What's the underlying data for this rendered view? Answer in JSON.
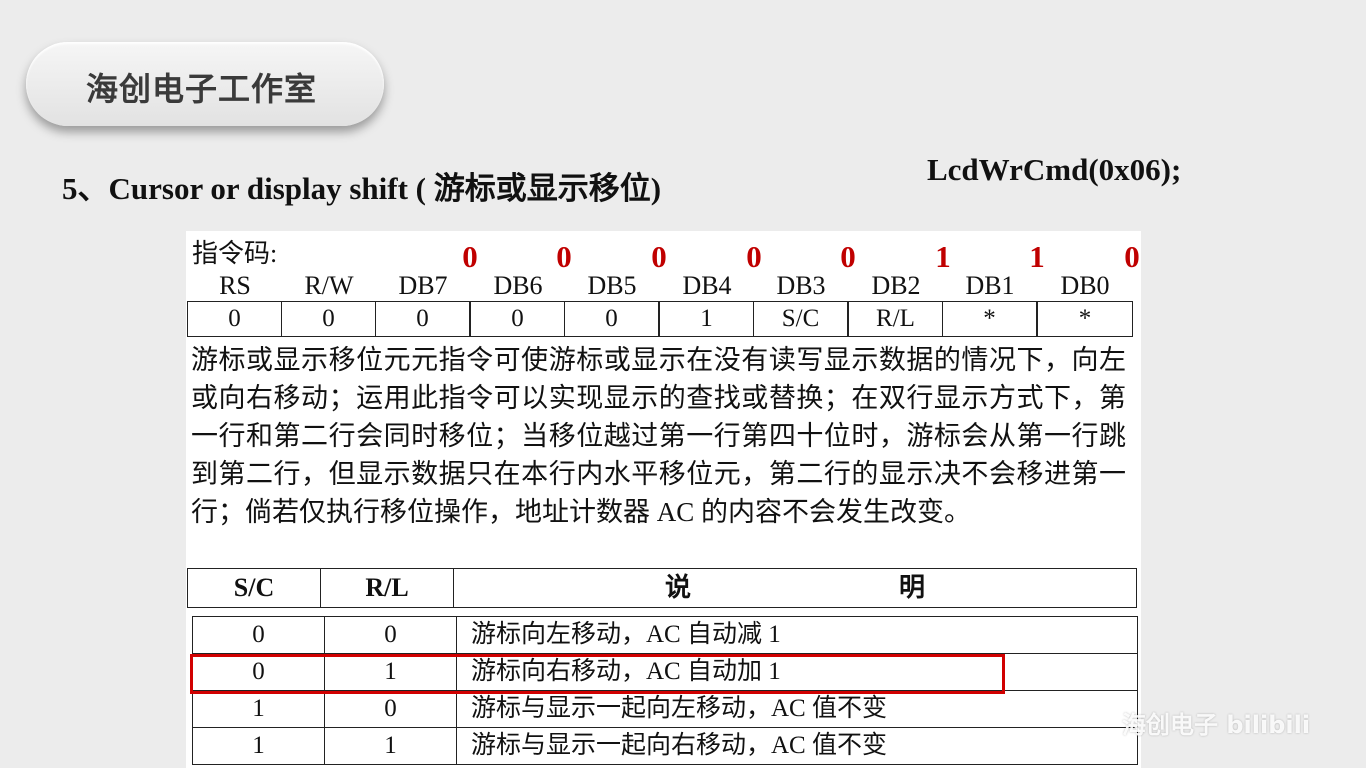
{
  "brand": "海创电子工作室",
  "section_title": "5、Cursor or display shift ( 游标或显示移位)",
  "command_code": "LcdWrCmd(0x06);",
  "opcode_label": "指令码:",
  "bits": [
    {
      "name": "RS",
      "value": "",
      "cell": "0"
    },
    {
      "name": "R/W",
      "value": "",
      "cell": "0"
    },
    {
      "name": "DB7",
      "value": "0",
      "cell": "0"
    },
    {
      "name": "DB6",
      "value": "0",
      "cell": "0"
    },
    {
      "name": "DB5",
      "value": "0",
      "cell": "0"
    },
    {
      "name": "DB4",
      "value": "0",
      "cell": "1"
    },
    {
      "name": "DB3",
      "value": "0",
      "cell": "S/C"
    },
    {
      "name": "DB2",
      "value": "1",
      "cell": "R/L"
    },
    {
      "name": "DB1",
      "value": "1",
      "cell": "*"
    },
    {
      "name": "DB0",
      "value": "0",
      "cell": "*"
    }
  ],
  "description": "游标或显示移位元元指令可使游标或显示在没有读写显示数据的情况下，向左或向右移动；运用此指令可以实现显示的查找或替换；在双行显示方式下，第一行和第二行会同时移位；当移位越过第一行第四十位时，游标会从第一行跳到第二行，但显示数据只在本行内水平移位元，第二行的显示决不会移进第一行；倘若仅执行移位操作，地址计数器 AC 的内容不会发生改变。",
  "table": {
    "headers": [
      "S/C",
      "R/L",
      "说　　　　　　　　明"
    ],
    "rows": [
      {
        "sc": "0",
        "rl": "0",
        "desc": "游标向左移动，AC 自动减 1"
      },
      {
        "sc": "0",
        "rl": "1",
        "desc": "游标向右移动，AC 自动加 1"
      },
      {
        "sc": "1",
        "rl": "0",
        "desc": "游标与显示一起向左移动，AC 值不变"
      },
      {
        "sc": "1",
        "rl": "1",
        "desc": "游标与显示一起向右移动，AC 值不变"
      }
    ],
    "highlight_color": "#d10000"
  },
  "watermark": "海创电子 bilibili"
}
